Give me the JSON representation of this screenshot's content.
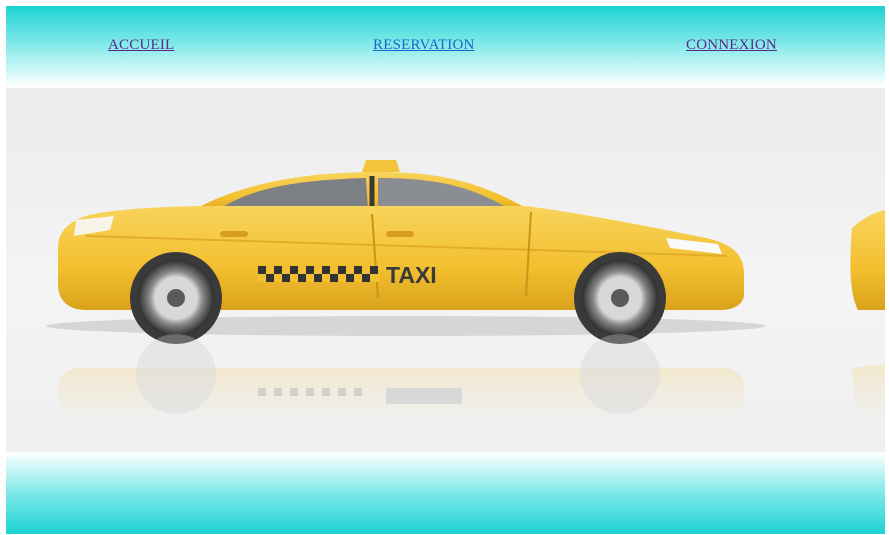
{
  "nav": {
    "items": [
      {
        "label": "ACCUEIL"
      },
      {
        "label": "RESERVATION"
      },
      {
        "label": "CONNEXION"
      }
    ]
  },
  "hero": {
    "car_door_text": "TAXI",
    "car_color": "#f5c53a"
  },
  "colors": {
    "header_top": "#1cd3d3",
    "link_visited": "#5a2a8a",
    "link_active": "#1f63c8"
  }
}
